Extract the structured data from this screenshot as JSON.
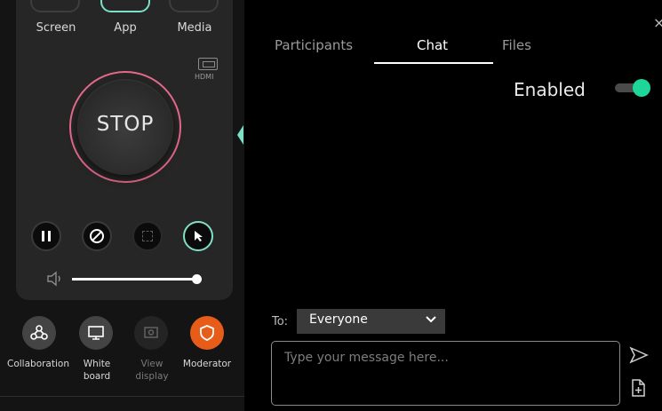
{
  "sources": [
    "Screen",
    "App",
    "Media"
  ],
  "hdmi_label": "HDMI",
  "stop_label": "STOP",
  "controls": [
    "pause-icon",
    "block-icon",
    "expand-icon",
    "pointer-icon"
  ],
  "modes": [
    {
      "label": "Collaboration",
      "line2": ""
    },
    {
      "label": "White",
      "line2": "board"
    },
    {
      "label": "View",
      "line2": "display"
    },
    {
      "label": "Moderator",
      "line2": ""
    }
  ],
  "volume": 0.92,
  "tabs": [
    "Participants",
    "Chat",
    "Files"
  ],
  "active_tab": "Chat",
  "close_label": "×",
  "chat_status": "Enabled",
  "chat_enabled": true,
  "recipient_prefix": "To:",
  "recipient": "Everyone",
  "message_placeholder": "Type your message here...",
  "colors": {
    "accent": "#7fe0c6",
    "toggle_on": "#1fd69a",
    "stop_ring": "#e56a8a",
    "moderator": "#e85c1a"
  }
}
